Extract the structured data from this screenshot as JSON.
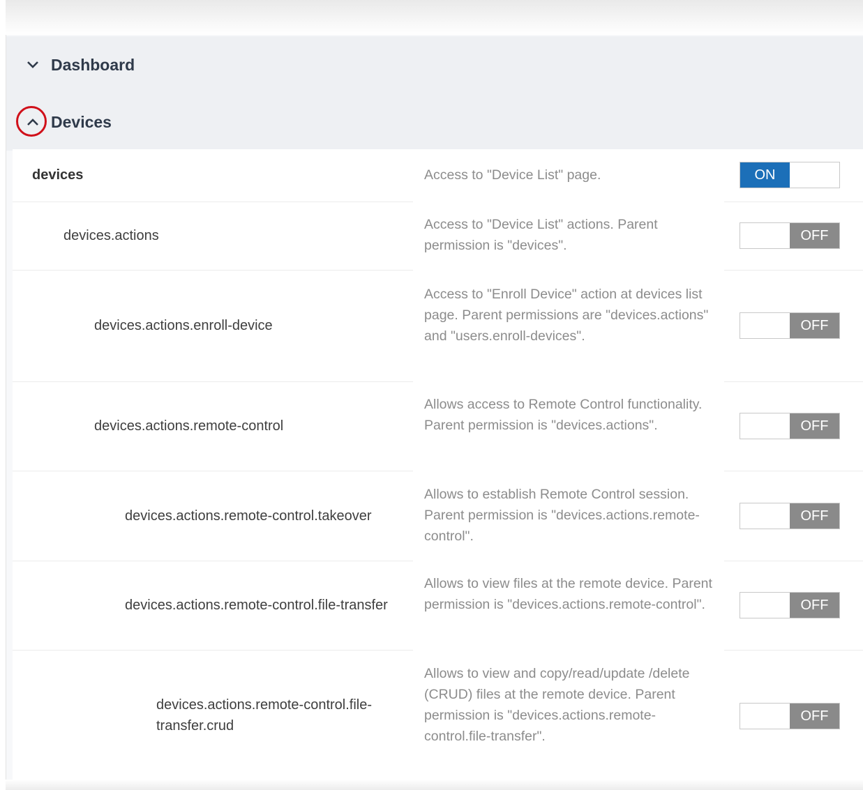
{
  "sections": {
    "dashboard": {
      "title": "Dashboard"
    },
    "devices": {
      "title": "Devices"
    }
  },
  "permissions": [
    {
      "name": "devices",
      "description": "Access to \"Device List\" page.",
      "state": "ON"
    },
    {
      "name": "devices.actions",
      "description": "Access to \"Device List\" actions. Parent permission is \"devices\".",
      "state": "OFF"
    },
    {
      "name": "devices.actions.enroll-device",
      "description": "Access to \"Enroll Device\" action at devices list page. Parent permissions are \"devices.actions\" and \"users.enroll-devices\".",
      "state": "OFF"
    },
    {
      "name": "devices.actions.remote-control",
      "description": "Allows access to Remote Control functionality. Parent permission is \"devices.actions\".",
      "state": "OFF"
    },
    {
      "name": "devices.actions.remote-control.takeover",
      "description": "Allows to establish Remote Control session. Parent permission is \"devices.actions.remote-control\".",
      "state": "OFF"
    },
    {
      "name": "devices.actions.remote-control.file-transfer",
      "description": "Allows to view files at the remote device. Parent permission is \"devices.actions.remote-control\".",
      "state": "OFF"
    },
    {
      "name": "devices.actions.remote-control.file-transfer.crud",
      "description": "Allows to view and copy/read/update /delete (CRUD) files at the remote device. Parent permission is \"devices.actions.remote-control.file-transfer\".",
      "state": "OFF"
    }
  ],
  "colors": {
    "toggle_on": "#1c6fb8",
    "toggle_off": "#8a8a8a",
    "highlight": "#d0101a"
  },
  "icons": {
    "dashboard_toggle": "chevron-down-icon",
    "devices_toggle": "chevron-up-icon"
  }
}
